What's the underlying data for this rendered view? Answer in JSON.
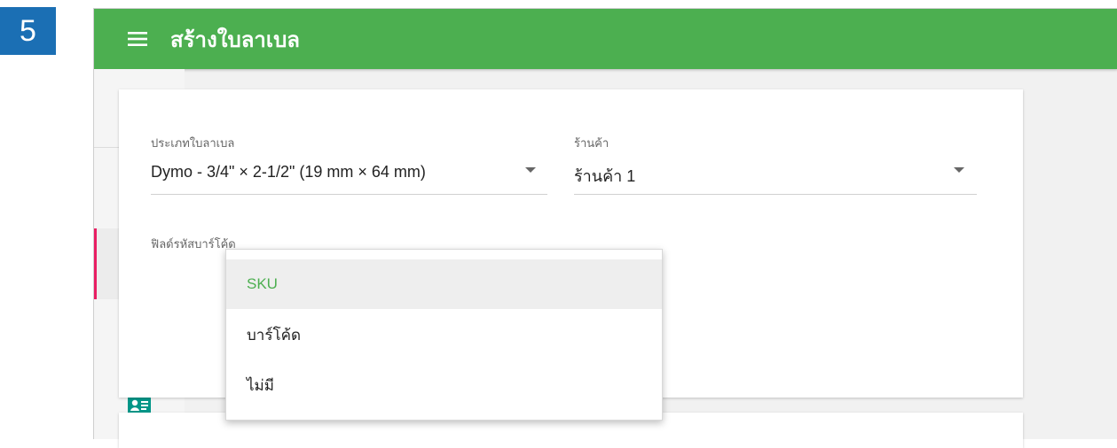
{
  "step": {
    "number": "5"
  },
  "header": {
    "title": "สร้างใบลาเบล",
    "menu_icon": "hamburger-menu-icon"
  },
  "sidebar": {
    "items": [
      {
        "icon": "account-circle-icon",
        "active": false
      },
      {
        "icon": "bar-chart-icon",
        "active": false
      },
      {
        "icon": "shopping-basket-icon",
        "active": true
      },
      {
        "icon": "cart-dolly-icon",
        "active": false
      },
      {
        "icon": "contact-card-icon",
        "active": false
      }
    ]
  },
  "form": {
    "label_type": {
      "label": "ประเภทใบลาเบล",
      "value": "Dymo - 3/4\" × 2-1/2\" (19 mm × 64 mm)"
    },
    "store": {
      "label": "ร้านค้า",
      "value": "ร้านค้า 1"
    },
    "barcode_field": {
      "label": "ฟิลด์รหัสบาร์โค้ด"
    }
  },
  "dropdown": {
    "options": [
      "SKU",
      "บาร์โค้ด",
      "ไม่มี"
    ],
    "selected": "SKU"
  },
  "colors": {
    "primary": "#4caf50",
    "accent": "#e91e63",
    "badge": "#1b6fb4"
  }
}
